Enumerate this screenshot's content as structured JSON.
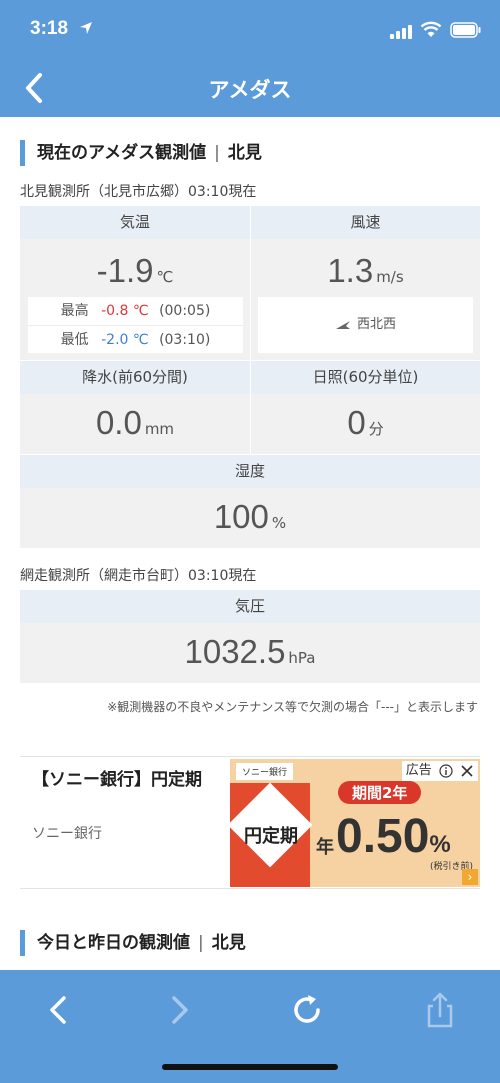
{
  "status_bar": {
    "time": "3:18"
  },
  "nav": {
    "title": "アメダス"
  },
  "section1": {
    "heading": "現在のアメダス観測値",
    "place": "北見"
  },
  "station1": {
    "label": "北見観測所（北見市広郷）03:10現在",
    "temperature": {
      "label": "気温",
      "value": "-1.9",
      "unit": "℃",
      "max_label": "最高",
      "max_value": "-0.8 ℃",
      "max_time": "(00:05)",
      "min_label": "最低",
      "min_value": "-2.0 ℃",
      "min_time": "(03:10)"
    },
    "wind": {
      "label": "風速",
      "value": "1.3",
      "unit": "m/s",
      "direction": "西北西"
    },
    "precip": {
      "label": "降水(前60分間)",
      "value": "0.0",
      "unit": "mm"
    },
    "sunshine": {
      "label": "日照(60分単位)",
      "value": "0",
      "unit": "分"
    },
    "humidity": {
      "label": "湿度",
      "value": "100",
      "unit": "%"
    }
  },
  "station2": {
    "label": "網走観測所（網走市台町）03:10現在",
    "pressure": {
      "label": "気圧",
      "value": "1032.5",
      "unit": "hPa"
    }
  },
  "note": "※観測機器の不良やメンテナンス等で欠測の場合「---」と表示します",
  "ad": {
    "title": "【ソニー銀行】円定期",
    "advertiser": "ソニー銀行",
    "badge": "広告",
    "bank_name": "ソニー銀行",
    "product": "円定期",
    "period": "期間2年",
    "nen": "年",
    "rate": "0.50",
    "percent": "%",
    "tax_note": "(税引き前)"
  },
  "section2": {
    "heading": "今日と昨日の観測値",
    "place": "北見"
  },
  "colors": {
    "brand": "#5b9bd9",
    "cell_header": "#e8eef6",
    "cell_body": "#f1f1f1",
    "max": "#d9373c",
    "min": "#3d7fcf"
  }
}
